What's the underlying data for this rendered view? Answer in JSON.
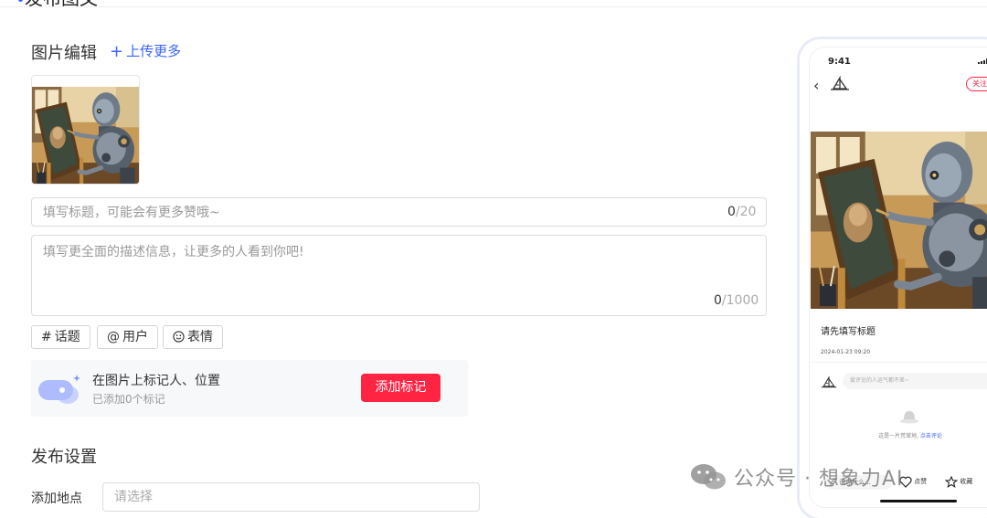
{
  "page": {
    "title": "发布图文"
  },
  "image_edit": {
    "section_title": "图片编辑",
    "upload_more_label": "上传更多",
    "thumbnail_alt": "robot painting"
  },
  "title_input": {
    "placeholder": "填写标题，可能会有更多赞哦~",
    "count": "0",
    "max": "/20"
  },
  "desc_input": {
    "placeholder": "填写更全面的描述信息，让更多的人看到你吧!",
    "count": "0",
    "max": "/1000"
  },
  "toolbar": {
    "topic": {
      "symbol": "#",
      "label": "话题"
    },
    "user": {
      "symbol": "@",
      "label": "用户"
    },
    "emoji": {
      "label": "表情"
    }
  },
  "tag_card": {
    "title": "在图片上标记人、位置",
    "subtitle": "已添加0个标记",
    "button_label": "添加标记"
  },
  "publish_settings": {
    "section_title": "发布设置",
    "location_label": "添加地点",
    "location_placeholder": "请选择"
  },
  "preview": {
    "time": "9:41",
    "follow_label": "关注",
    "title": "请先填写标题",
    "date": "2024-01-23 09:20",
    "comment_placeholder": "爱评论的人运气都不差~",
    "empty_text": "这是一片荒草地, ",
    "empty_link": "点击评论",
    "say_label": "说点什么...",
    "like_label": "点赞",
    "collect_label": "收藏"
  },
  "watermark": {
    "text": "公众号 · 想象力AI"
  },
  "colors": {
    "accent": "#3a64ff",
    "brand_red": "#ff2442",
    "border": "#dcdcdc",
    "placeholder": "#999999"
  }
}
